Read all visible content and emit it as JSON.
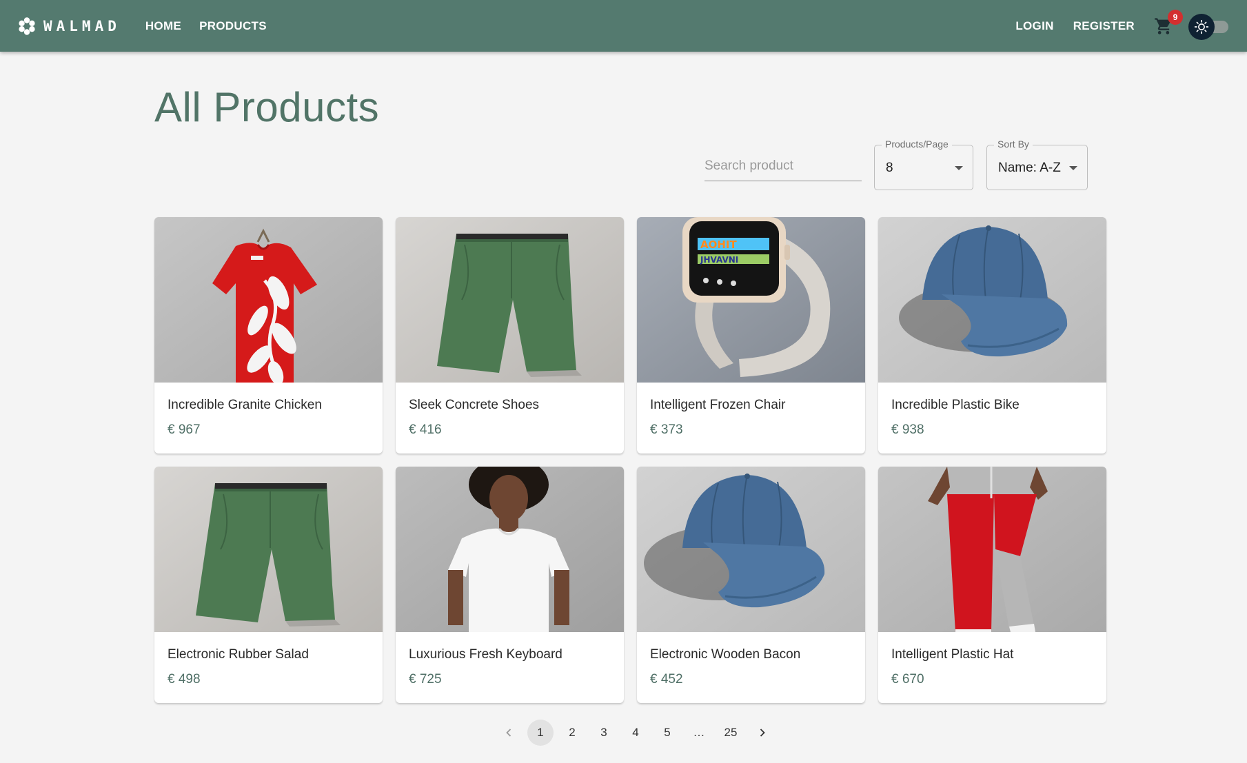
{
  "header": {
    "brand": "WALMAD",
    "nav": [
      {
        "label": "HOME"
      },
      {
        "label": "PRODUCTS"
      }
    ],
    "login_label": "LOGIN",
    "register_label": "REGISTER",
    "cart_count": "9",
    "brand_color": "#547a6f"
  },
  "main": {
    "title": "All Products",
    "search_placeholder": "Search product",
    "per_page_label": "Products/Page",
    "per_page_value": "8",
    "sort_label": "Sort By",
    "sort_value": "Name: A-Z"
  },
  "products": [
    {
      "name": "Incredible Granite Chicken",
      "price": "€ 967",
      "image": "red-tshirt"
    },
    {
      "name": "Sleek Concrete Shoes",
      "price": "€ 416",
      "image": "green-shorts"
    },
    {
      "name": "Intelligent Frozen Chair",
      "price": "€ 373",
      "image": "smartwatch"
    },
    {
      "name": "Incredible Plastic Bike",
      "price": "€ 938",
      "image": "blue-cap"
    },
    {
      "name": "Electronic Rubber Salad",
      "price": "€ 498",
      "image": "green-shorts"
    },
    {
      "name": "Luxurious Fresh Keyboard",
      "price": "€ 725",
      "image": "white-tshirt"
    },
    {
      "name": "Electronic Wooden Bacon",
      "price": "€ 452",
      "image": "blue-cap"
    },
    {
      "name": "Intelligent Plastic Hat",
      "price": "€ 670",
      "image": "track-pants"
    }
  ],
  "pagination": {
    "pages": [
      "1",
      "2",
      "3",
      "4",
      "5",
      "…",
      "25"
    ],
    "current": "1"
  }
}
